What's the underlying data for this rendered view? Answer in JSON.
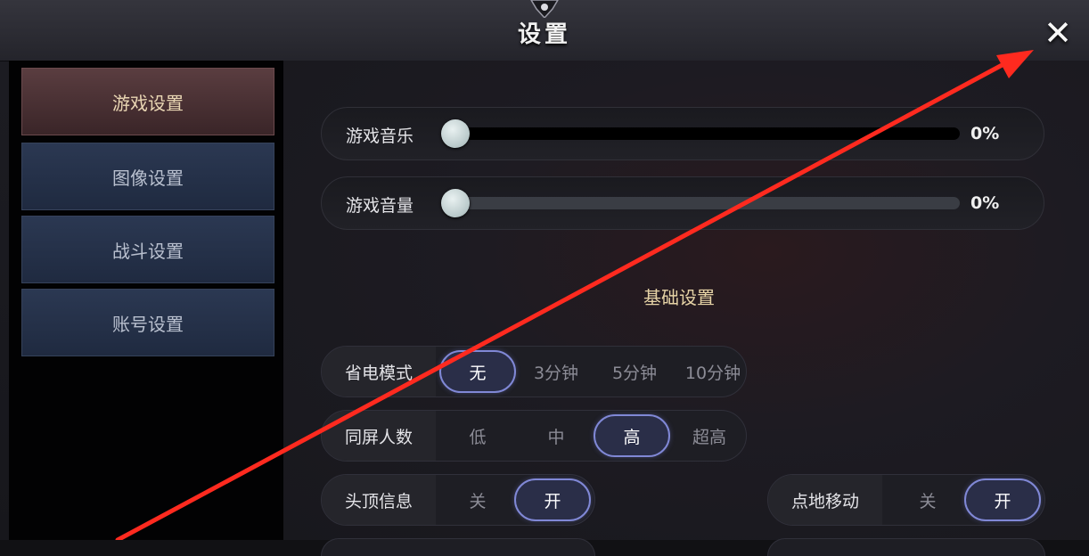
{
  "window": {
    "title": "设置",
    "close_icon": "close-icon"
  },
  "sidebar": {
    "items": [
      {
        "label": "游戏设置",
        "active": true
      },
      {
        "label": "图像设置",
        "active": false
      },
      {
        "label": "战斗设置",
        "active": false
      },
      {
        "label": "账号设置",
        "active": false
      }
    ]
  },
  "audio": {
    "music": {
      "label": "游戏音乐",
      "value_text": "0%",
      "value": 0
    },
    "volume": {
      "label": "游戏音量",
      "value_text": "0%",
      "value": 0
    }
  },
  "basic": {
    "section_title": "基础设置",
    "power_save": {
      "label": "省电模式",
      "options": [
        "无",
        "3分钟",
        "5分钟",
        "10分钟"
      ],
      "selected": "无"
    },
    "same_screen": {
      "label": "同屏人数",
      "options": [
        "低",
        "中",
        "高",
        "超高"
      ],
      "selected": "高"
    },
    "head_info": {
      "label": "头顶信息",
      "options": [
        "关",
        "开"
      ],
      "selected": "开"
    },
    "tap_move": {
      "label": "点地移动",
      "options": [
        "关",
        "开"
      ],
      "selected": "开"
    }
  },
  "colors": {
    "annotation_arrow": "#ff2a1f",
    "accent_selected": "#8088d6",
    "sidebar_active": "#4a3033"
  }
}
